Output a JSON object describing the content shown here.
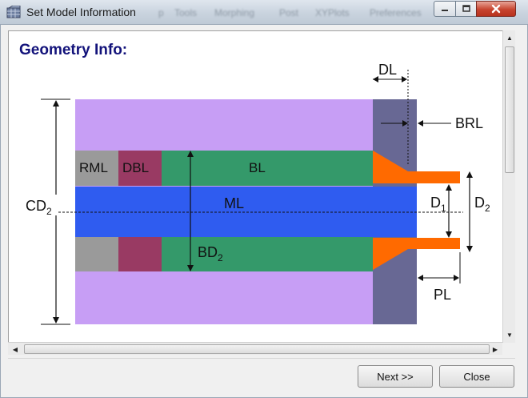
{
  "window": {
    "title": "Set Model Information",
    "background_menu": [
      "p",
      "Tools",
      "Morphing",
      "Post",
      "XYPlots",
      "Preferences"
    ]
  },
  "panel": {
    "heading": "Geometry Info:"
  },
  "diagram": {
    "labels": {
      "rml": "RML",
      "dbl": "DBL",
      "bl": "BL",
      "ml": "ML",
      "dl": "DL",
      "brl": "BRL",
      "cd": "CD",
      "cd_sub": "2",
      "bd": "BD",
      "bd_sub": "2",
      "d1": "D",
      "d1_sub": "1",
      "d2": "D",
      "d2_sub": "2",
      "pl": "PL"
    },
    "colors": {
      "lilac": "#c79ef5",
      "dark_slate": "#686894",
      "green": "#34996a",
      "blue": "#2f5cf0",
      "gray": "#9a9a9a",
      "maroon": "#993a63",
      "orange": "#ff6a00"
    }
  },
  "buttons": {
    "next": "Next >>",
    "close": "Close"
  },
  "icons": {
    "app": "grid-app-icon",
    "minimize": "minimize-icon",
    "maximize": "maximize-icon",
    "close": "close-x-icon",
    "scroll_up": "arrow-up-icon",
    "scroll_down": "arrow-down-icon",
    "scroll_left": "arrow-left-icon",
    "scroll_right": "arrow-right-icon"
  }
}
